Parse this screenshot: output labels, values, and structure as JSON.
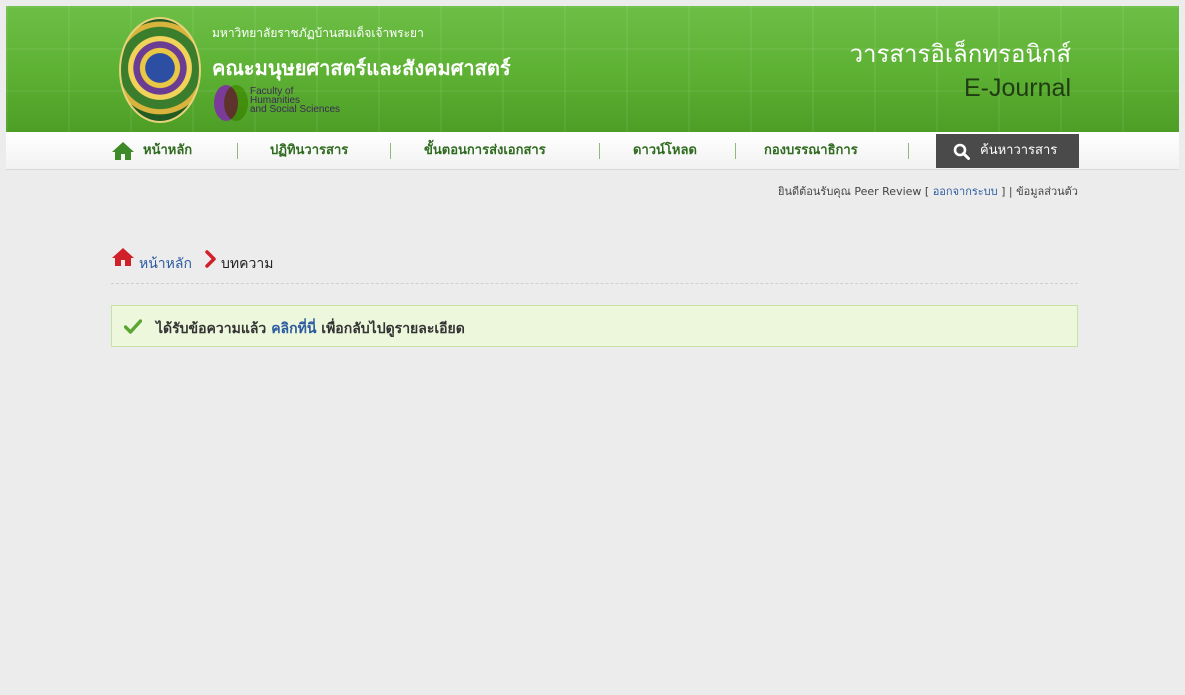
{
  "header": {
    "university": "มหาวิทยาลัยราชภัฏบ้านสมเด็จเจ้าพระยา",
    "faculty": "คณะมนุษยศาสตร์และสังคมศาสตร์",
    "faculty_en_line1": "Faculty of",
    "faculty_en_line2": "Humanities",
    "faculty_en_line3": "and Social Sciences",
    "journal_th": "วารสารอิเล็กทรอนิกส์",
    "journal_en": "E-Journal"
  },
  "nav": {
    "items": [
      {
        "label": "หน้าหลัก",
        "icon": "home-icon"
      },
      {
        "label": "ปฏิทินวารสาร"
      },
      {
        "label": "ขั้นตอนการส่งเอกสาร"
      },
      {
        "label": "ดาวน์โหลด"
      },
      {
        "label": "กองบรรณาธิการ"
      }
    ],
    "search_label": "ค้นหาวารสาร",
    "search_icon": "search-icon"
  },
  "welcome": {
    "text": "ยินดีต้อนรับคุณ Peer Review [",
    "logout": "ออกจากระบบ",
    "sep": "] |",
    "profile": "ข้อมูลส่วนตัว"
  },
  "breadcrumb": {
    "home": "หน้าหลัก",
    "current": "บทความ"
  },
  "alert": {
    "text_before": "ได้รับข้อความแล้ว",
    "link": "คลิกที่นี่",
    "text_after": "เพื่อกลับไปดูรายละเอียด"
  },
  "colors": {
    "header_green": "#5cb032",
    "nav_text": "#2f6b1f",
    "link_blue": "#2c5aa0",
    "breadcrumb_red": "#d0202a",
    "search_bg": "#4a4a4a",
    "alert_bg": "#ecf7dc"
  }
}
